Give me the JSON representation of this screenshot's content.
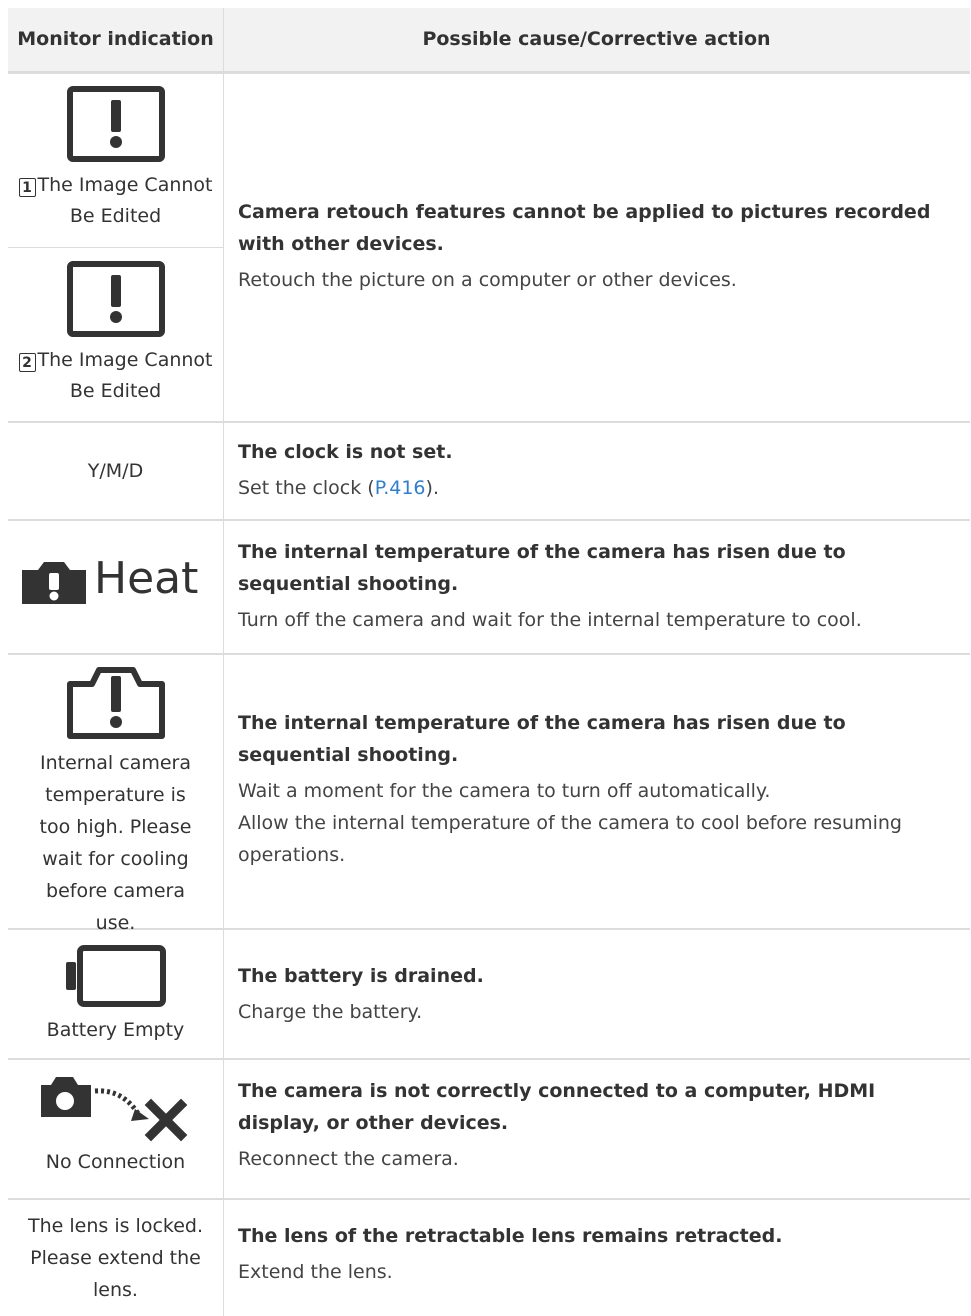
{
  "header": {
    "col1": "Monitor indication",
    "col2": "Possible cause/Corrective action"
  },
  "rows": {
    "edit": {
      "ind1_num": "1",
      "ind1_text": "The Image Cannot Be Edited",
      "ind2_num": "2",
      "ind2_text": "The Image Cannot Be Edited",
      "cause": "Camera retouch features cannot be applied to pictures recorded with other devices.",
      "action": "Retouch the picture on a computer or other devices."
    },
    "clock": {
      "indication": "Y/M/D",
      "cause": "The clock is not set.",
      "action_pre": "Set the clock (",
      "action_link": "P.416",
      "action_post": ")."
    },
    "heat": {
      "indication": "Heat",
      "cause": "The internal temperature of the camera has risen due to sequential shooting.",
      "action": "Turn off the camera and wait for the internal temperature to cool."
    },
    "temp": {
      "indication": "Internal camera temperature is too high. Please wait for cooling before camera use.",
      "cause": "The internal temperature of the camera has risen due to sequential shooting.",
      "action1": "Wait a moment for the camera to turn off automatically.",
      "action2": "Allow the internal temperature of the camera to cool before resuming operations."
    },
    "battery": {
      "indication": "Battery Empty",
      "cause": "The battery is drained.",
      "action": "Charge the battery."
    },
    "connection": {
      "indication": "No Connection",
      "cause": "The camera is not correctly connected to a computer, HDMI display, or other devices.",
      "action": "Reconnect the camera."
    },
    "lens": {
      "indication": "The lens is locked. Please extend the lens.",
      "cause": "The lens of the retractable lens remains retracted.",
      "action": "Extend the lens."
    }
  }
}
